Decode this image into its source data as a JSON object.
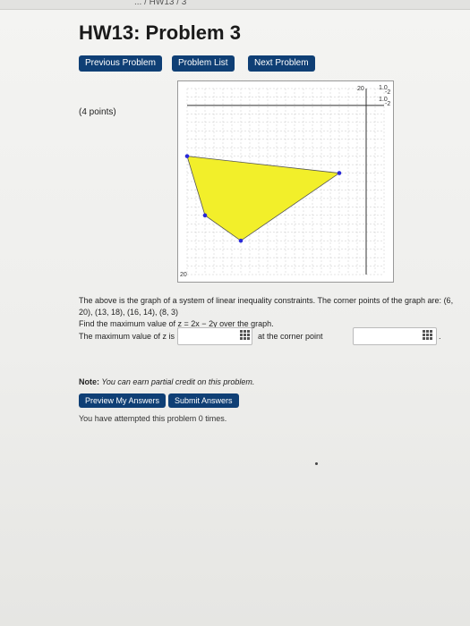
{
  "breadcrumb": "... / HW13 / 3",
  "title": "HW13: Problem 3",
  "nav": {
    "previous": "Previous Problem",
    "list": "Problem List",
    "next": "Next Problem"
  },
  "points_label": "(4 points)",
  "graph": {
    "tick_labels": [
      "20",
      "20",
      "1.0",
      "-2",
      "1.0",
      "-2"
    ]
  },
  "chart_data": {
    "type": "scatter",
    "corner_points": [
      {
        "x": 6,
        "y": 20
      },
      {
        "x": 13,
        "y": 18
      },
      {
        "x": 16,
        "y": 14
      },
      {
        "x": 8,
        "y": 3
      }
    ],
    "region_color": "#f2ef2a",
    "point_color": "#2a2ad8",
    "xlim": [
      -2,
      20
    ],
    "ylim": [
      -2,
      20
    ],
    "grid": true
  },
  "problem": {
    "line1_prefix": "The above is the graph of a system of linear inequality constraints. The corner points of the graph are: ",
    "corner_points_text": "(6, 20), (13, 18), (16, 14), (8, 3)",
    "line2": "Find the maximum value of z = 2x − 2y over the graph.",
    "answer_prefix": "The maximum value of z is",
    "answer_mid": "at the corner point",
    "answer_suffix": ".",
    "answer_value_1": "",
    "answer_value_2": ""
  },
  "note": {
    "label": "Note:",
    "text": " You can earn partial credit on this problem."
  },
  "actions": {
    "preview": "Preview My Answers",
    "submit": "Submit Answers"
  },
  "attempts_text": "You have attempted this problem 0 times."
}
